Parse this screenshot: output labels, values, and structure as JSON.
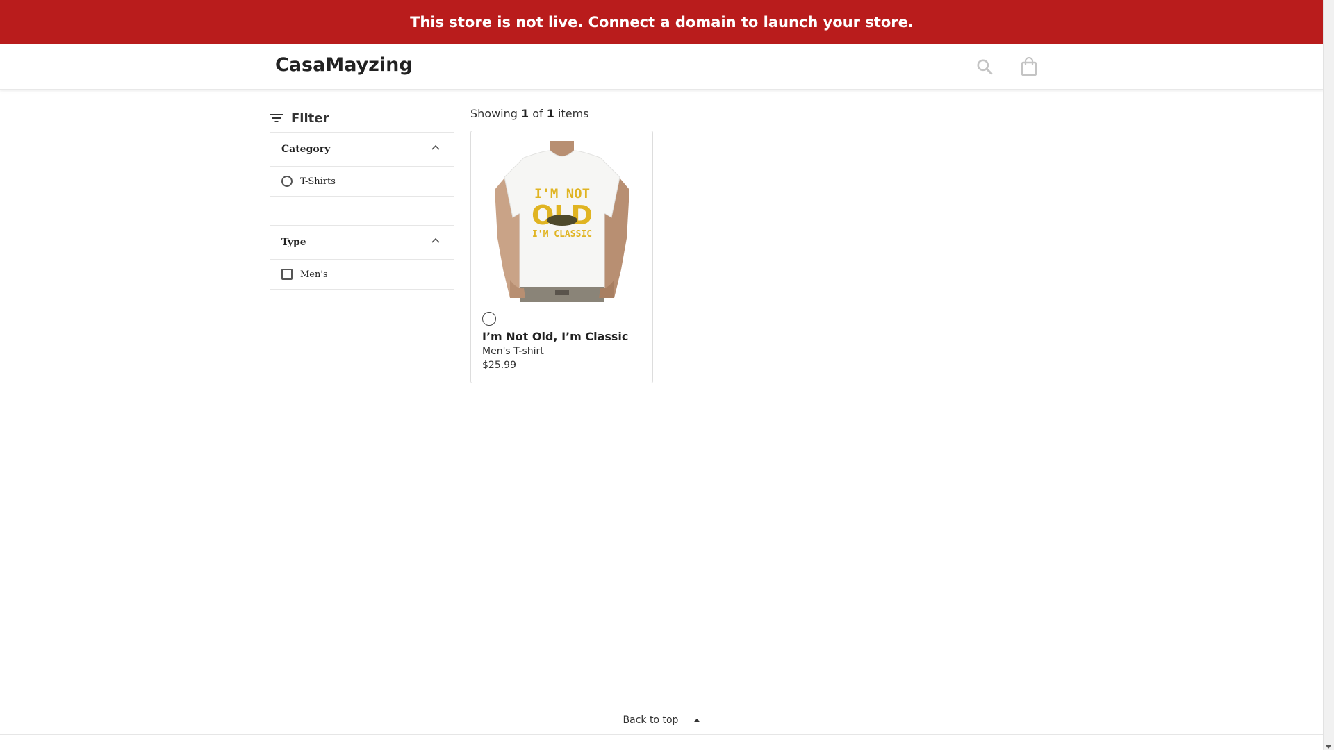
{
  "banner": {
    "text": "This store is not live. Connect a domain to launch your store."
  },
  "header": {
    "brand": "CasaMayzing",
    "search_icon": "search-icon",
    "cart_icon": "shopping-bag-icon"
  },
  "filters": {
    "title": "Filter",
    "facets": [
      {
        "label": "Category",
        "options": [
          {
            "label": "T-Shirts",
            "control": "radio",
            "selected": false
          }
        ]
      },
      {
        "label": "Type",
        "options": [
          {
            "label": "Men's",
            "control": "checkbox",
            "checked": false
          }
        ]
      }
    ]
  },
  "results": {
    "prefix": "Showing",
    "shown": "1",
    "of": "of",
    "total": "1",
    "suffix": "items"
  },
  "products": [
    {
      "name": "I’m Not Old, I’m Classic",
      "type": "Men's T-shirt",
      "price": "$25.99",
      "shirt_text": [
        "I'M NOT",
        "OLD",
        "I'M CLASSIC"
      ],
      "swatch_color": "#ffffff"
    }
  ],
  "footer": {
    "back_to_top": "Back to top"
  },
  "colors": {
    "banner": "#b91c1c",
    "print_gold": "#e0b422"
  }
}
